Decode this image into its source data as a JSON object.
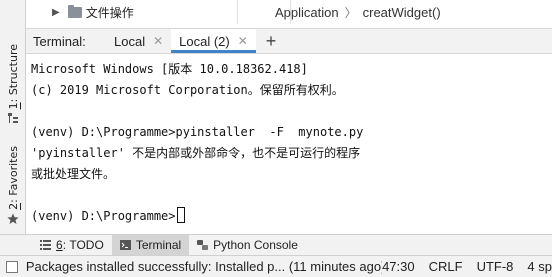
{
  "side_tabs": [
    {
      "number": "1",
      "label": "Structure"
    },
    {
      "number": "2",
      "label": "Favorites"
    }
  ],
  "project_row": {
    "folder_label": "文件操作"
  },
  "breadcrumb": {
    "class_name": "Application",
    "method_name": "creatWidget()"
  },
  "terminal_header": {
    "title": "Terminal:",
    "tabs": [
      {
        "label": "Local",
        "active": false
      },
      {
        "label": "Local (2)",
        "active": true
      }
    ],
    "add_symbol": "+"
  },
  "terminal_lines": [
    "Microsoft Windows [版本 10.0.18362.418]",
    "(c) 2019 Microsoft Corporation。保留所有权利。",
    "",
    "(venv) D:\\Programme>pyinstaller  -F  mynote.py",
    "'pyinstaller' 不是内部或外部命令，也不是可运行的程序",
    "或批处理文件。",
    "",
    "(venv) D:\\Programme>"
  ],
  "tool_windows": [
    {
      "number": "6",
      "label": "TODO",
      "active": false
    },
    {
      "number": "",
      "label": "Terminal",
      "active": true
    },
    {
      "number": "",
      "label": "Python Console",
      "active": false
    }
  ],
  "status_bar": {
    "message": "Packages installed successfully: Installed p... (11 minutes ago)",
    "position": "47:30",
    "line_separator": "CRLF",
    "encoding": "UTF-8",
    "indent": "4 sp"
  },
  "colors": {
    "accent": "#4083c9",
    "panel_bg": "#f2f2f2",
    "terminal_bg": "#ffffff"
  }
}
